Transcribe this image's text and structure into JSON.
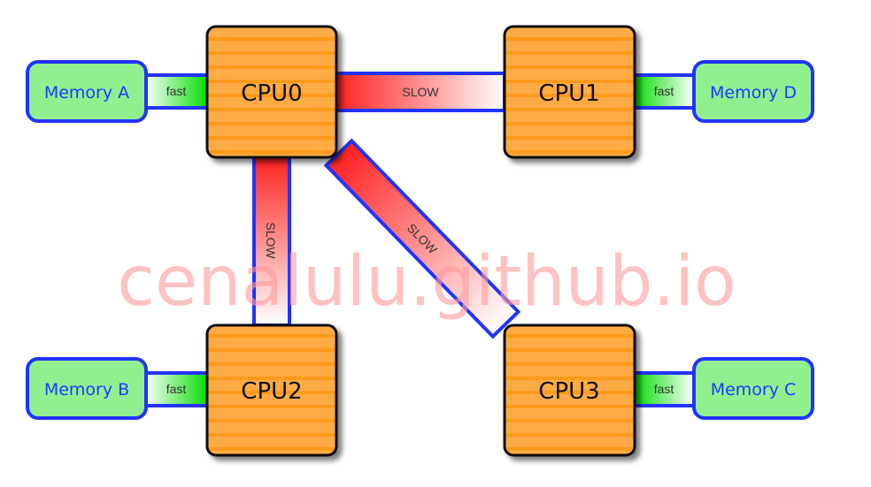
{
  "cpus": [
    {
      "label": "CPU0"
    },
    {
      "label": "CPU1"
    },
    {
      "label": "CPU2"
    },
    {
      "label": "CPU3"
    }
  ],
  "memories": [
    {
      "label": "Memory A"
    },
    {
      "label": "Memory D"
    },
    {
      "label": "Memory B"
    },
    {
      "label": "Memory C"
    }
  ],
  "links": {
    "fast": "fast",
    "slow": "SLOW"
  },
  "watermark": "cenalulu.github.io",
  "colors": {
    "cpu": "#ffa940",
    "memory": "#90f090",
    "border": "#2233ff",
    "slow": "#ff2a2a",
    "fast": "#00dd00"
  }
}
